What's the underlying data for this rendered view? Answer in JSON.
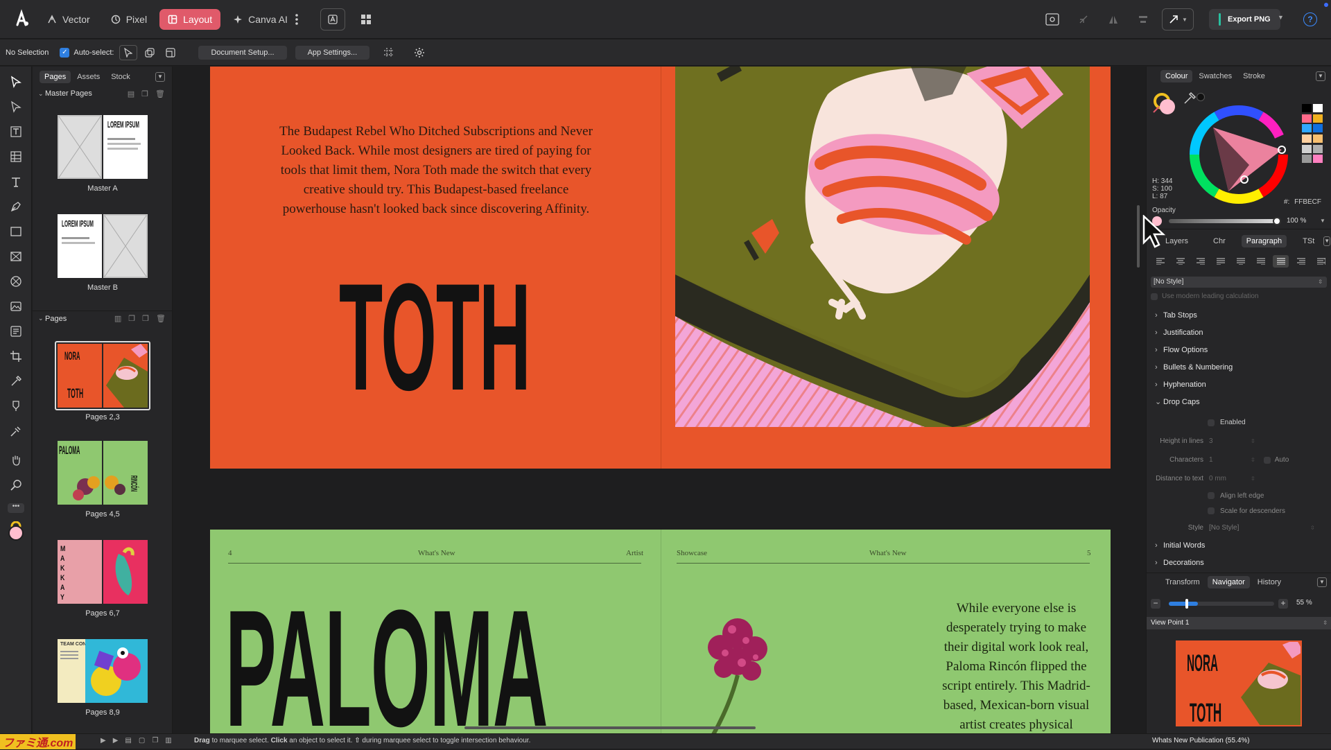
{
  "topbar": {
    "personas": [
      {
        "label": "Vector",
        "icon": "vector-pen-icon"
      },
      {
        "label": "Pixel",
        "icon": "pixel-brush-icon"
      },
      {
        "label": "Layout",
        "icon": "layout-grid-icon"
      },
      {
        "label": "Canva AI",
        "icon": "sparkle-icon"
      }
    ],
    "export_label": "Export PNG",
    "accent": "#e05a6a"
  },
  "context": {
    "selection": "No Selection",
    "auto_select": "Auto-select:",
    "document_setup": "Document Setup...",
    "app_settings": "App Settings..."
  },
  "left_panel": {
    "tabs": [
      "Pages",
      "Assets",
      "Stock"
    ],
    "master_header": "Master Pages",
    "masters": [
      {
        "label": "Master A",
        "lorem": "LOREM IPSUM"
      },
      {
        "label": "Master B",
        "lorem": "LOREM IPSUM"
      }
    ],
    "pages_header": "Pages",
    "pages": [
      {
        "label": "Pages 2,3",
        "title_a": "NORA",
        "title_b": "TOTH"
      },
      {
        "label": "Pages 4,5",
        "title_a": "PALOMA",
        "title_b": "RINCÓN"
      },
      {
        "label": "Pages 6,7",
        "title_a": "MAKKAY"
      },
      {
        "label": "Pages 8,9",
        "title_a": "TEAM CONCEP"
      }
    ]
  },
  "canvas": {
    "spread1": {
      "intro": "The Budapest Rebel Who Ditched Subscriptions and Never Looked Back. While most designers are tired of paying for tools that limit them, Nora Toth made the switch that every creative should try. This Budapest-based freelance powerhouse hasn't looked back since discovering Affinity.",
      "headline": "TOTH",
      "bg": "#e8552a"
    },
    "spread2": {
      "header_left": [
        "4",
        "What's New",
        "Artist"
      ],
      "header_right": [
        "Showcase",
        "What's New",
        "5"
      ],
      "headline": "PALOMA",
      "body": "While everyone else is desperately trying to make their digital work look real, Paloma Rincón flipped the script entirely. This Madrid-based, Mexican-born visual artist creates physical",
      "bg": "#8fc870"
    }
  },
  "right_panel": {
    "colour_tabs": [
      "Colour",
      "Swatches",
      "Stroke"
    ],
    "hsl": {
      "h": "H: 344",
      "s": "S: 100",
      "l": "L: 87"
    },
    "hex_label": "#:",
    "hex": "FFBECF",
    "fill_color": "#ffbecf",
    "opacity_label": "Opacity",
    "opacity_value": "100 %",
    "text_tabs": [
      "Layers",
      "Chr",
      "Paragraph",
      "TSt"
    ],
    "style_select": "[No Style]",
    "leading_label": "Use modern leading calculation",
    "sections": [
      "Tab Stops",
      "Justification",
      "Flow Options",
      "Bullets & Numbering",
      "Hyphenation",
      "Drop Caps"
    ],
    "dropcaps": {
      "enabled": "Enabled",
      "height_label": "Height in lines",
      "height_value": "3",
      "chars_label": "Characters",
      "chars_value": "1",
      "auto": "Auto",
      "dist_label": "Distance to text",
      "dist_value": "0 mm",
      "align_left": "Align left edge",
      "scale_desc": "Scale for descenders",
      "style_label": "Style",
      "style_value": "[No Style]"
    },
    "more_sections": [
      "Initial Words",
      "Decorations"
    ],
    "nav_tabs": [
      "Transform",
      "Navigator",
      "History"
    ],
    "zoom_value": "55 %",
    "zoom_level": 0.55,
    "view_point": "View Point 1",
    "preview": {
      "title_a": "NORA",
      "title_b": "TOTH"
    }
  },
  "status": {
    "hint_1": "Drag",
    "hint_2": " to marquee select. ",
    "hint_3": "Click",
    "hint_4": " an object to select it. ",
    "hint_5": "⇧",
    "hint_6": " during marquee select to toggle intersection behaviour.",
    "document": "Whats New Publication (55.4%)",
    "watermark": "ファミ通.com"
  }
}
